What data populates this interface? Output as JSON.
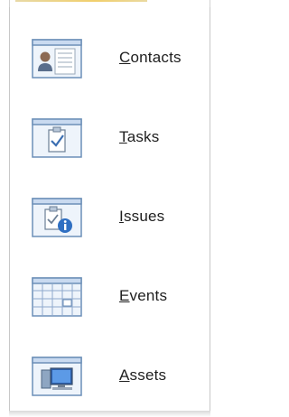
{
  "menu": {
    "items": [
      {
        "label": "Contacts",
        "mnemonic": "C",
        "rest": "ontacts",
        "icon": "contacts-list-icon"
      },
      {
        "label": "Tasks",
        "mnemonic": "T",
        "rest": "asks",
        "icon": "tasks-list-icon"
      },
      {
        "label": "Issues",
        "mnemonic": "I",
        "rest": "ssues",
        "icon": "issues-list-icon"
      },
      {
        "label": "Events",
        "mnemonic": "E",
        "rest": "vents",
        "icon": "events-calendar-icon"
      },
      {
        "label": "Assets",
        "mnemonic": "A",
        "rest": "ssets",
        "icon": "assets-list-icon"
      }
    ]
  },
  "colors": {
    "accent": "#f1cf6c",
    "border": "#c8c8c8",
    "icon_frame": "#6c8fb8",
    "icon_header": "#c9daf0"
  }
}
